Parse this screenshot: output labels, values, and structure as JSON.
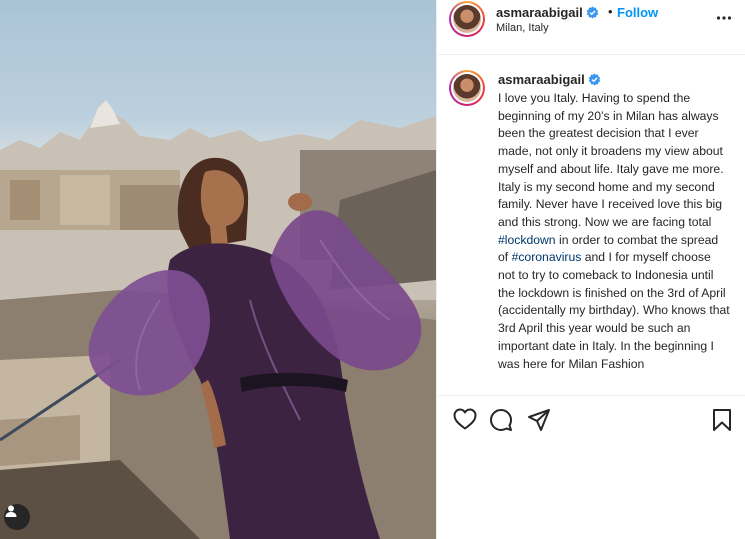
{
  "post": {
    "username": "asmaraabigail",
    "verified": true,
    "follow_label": "Follow",
    "separator": "•",
    "location": "Milan, Italy",
    "caption": {
      "part1": "I love you Italy. Having to spend the beginning of my 20’s in Milan has always been the greatest decision that I ever made, not only it broadens my view about myself and about life. Italy gave me more. Italy is my second home and my second family. Never have I received love this big and this strong. Now we are facing total ",
      "hashtag1": "#lockdown",
      "part2": " in order to combat the spread of ",
      "hashtag2": "#coronavirus",
      "part3": " and I for myself choose not to try to comeback to Indonesia until the lockdown is finished on the 3rd of April (accidentally my birthday). Who knows that 3rd April this year would be such an important date in Italy. In the beginning I was here for Milan Fashion"
    }
  },
  "icons": {
    "more": "more-options-icon",
    "like": "heart-icon",
    "comment": "comment-icon",
    "share": "share-icon",
    "save": "bookmark-icon",
    "user_tag": "user-tag-icon",
    "verified": "verified-badge-icon"
  },
  "colors": {
    "link_blue": "#0095f6",
    "hashtag": "#00376b",
    "text": "#262626",
    "verified": "#3897f0"
  }
}
